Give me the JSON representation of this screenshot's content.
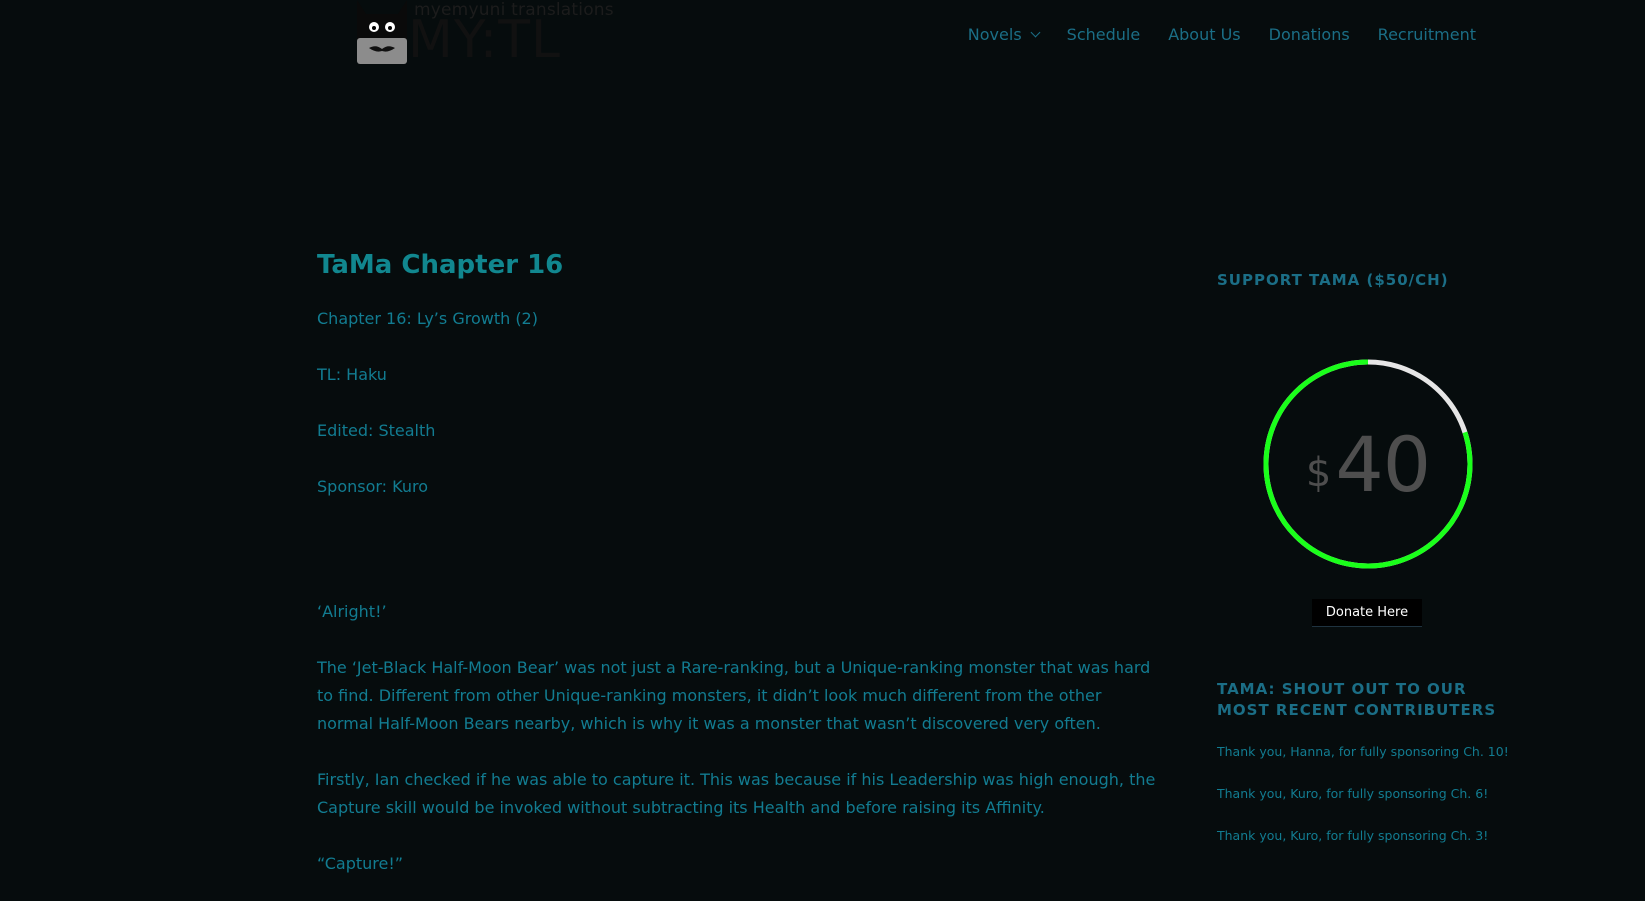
{
  "header": {
    "logo_tagline": "myemyuni translations",
    "logo_text": "MY:TL",
    "nav": [
      {
        "label": "Novels",
        "has_dropdown": true
      },
      {
        "label": "Schedule"
      },
      {
        "label": "About Us"
      },
      {
        "label": "Donations"
      },
      {
        "label": "Recruitment"
      }
    ]
  },
  "article": {
    "title": "TaMa Chapter 16",
    "meta": [
      "Chapter 16: Ly’s Growth (2)",
      "TL: Haku",
      "Edited: Stealth",
      "Sponsor: Kuro"
    ],
    "paragraphs": [
      "‘Alright!’",
      "The ‘Jet-Black Half-Moon Bear’ was not just a Rare-ranking, but a Unique-ranking monster that was hard to find. Different from other Unique-ranking monsters, it didn’t look much different from the other normal Half-Moon Bears nearby, which is why it was a monster that wasn’t discovered very often.",
      "Firstly, Ian checked if he was able to capture it. This was because if his Leadership was high enough, the Capture skill would be invoked without subtracting its Health and before raising its Affinity.",
      "“Capture!”"
    ]
  },
  "sidebar": {
    "support_title": "SUPPORT TAMA ($50/CH)",
    "gauge": {
      "currency": "$",
      "amount": "40",
      "fraction": 0.8,
      "fill_color": "#1aff1a",
      "track_color": "#e6e6e6"
    },
    "donate_label": "Donate Here",
    "shout_title": "TAMA: SHOUT OUT TO OUR MOST RECENT CONTRIBUTERS",
    "shoutouts": [
      "Thank you, Hanna, for fully sponsoring Ch. 10!",
      "Thank you, Kuro, for fully sponsoring Ch. 6!",
      "Thank you, Kuro, for fully sponsoring Ch. 3!"
    ]
  }
}
